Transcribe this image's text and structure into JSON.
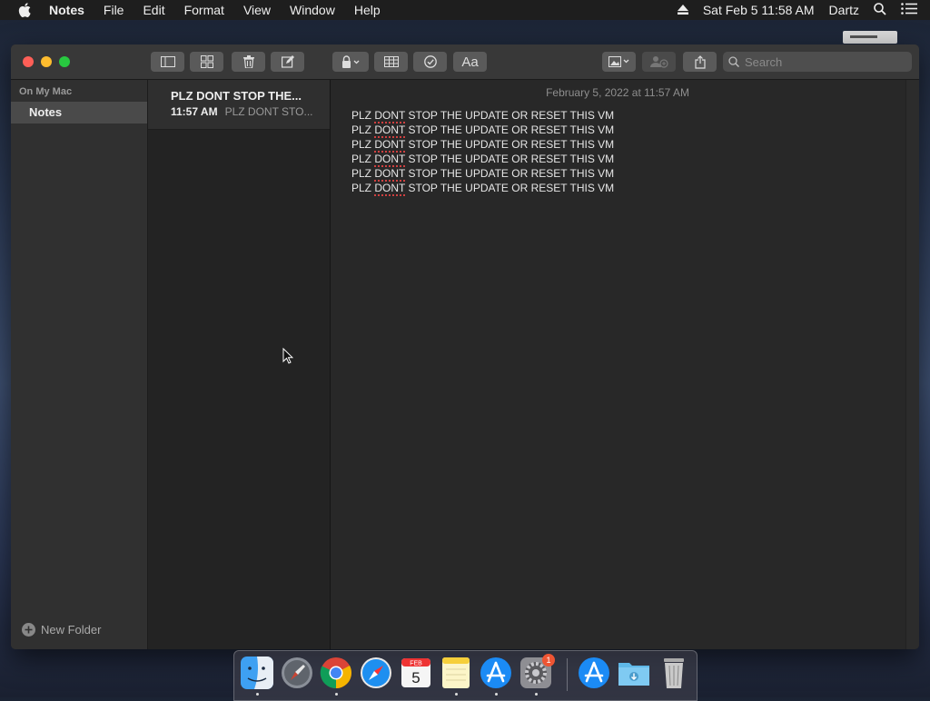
{
  "menubar": {
    "app_name": "Notes",
    "items": [
      "File",
      "Edit",
      "Format",
      "View",
      "Window",
      "Help"
    ],
    "datetime": "Sat Feb 5  11:58 AM",
    "user": "Dartz"
  },
  "toolbar": {
    "search_placeholder": "Search"
  },
  "sidebar": {
    "section_label": "On My Mac",
    "folder_label": "Notes",
    "new_folder_label": "New Folder"
  },
  "note_list": {
    "notes": [
      {
        "title": "PLZ DONT STOP THE...",
        "time": "11:57 AM",
        "preview": "PLZ DONT STO..."
      }
    ]
  },
  "editor": {
    "date": "February 5, 2022 at 11:57 AM",
    "lines": [
      {
        "before": "PLZ ",
        "misspelled": "DONT",
        "after": " STOP THE UPDATE OR RESET THIS VM"
      },
      {
        "before": "PLZ ",
        "misspelled": "DONT",
        "after": " STOP THE UPDATE OR RESET THIS VM"
      },
      {
        "before": "PLZ ",
        "misspelled": "DONT",
        "after": " STOP THE UPDATE OR RESET THIS VM"
      },
      {
        "before": "PLZ ",
        "misspelled": "DONT",
        "after": " STOP THE UPDATE OR RESET THIS VM"
      },
      {
        "before": "PLZ ",
        "misspelled": "DONT",
        "after": " STOP THE UPDATE OR RESET THIS VM"
      },
      {
        "before": "PLZ ",
        "misspelled": "DONT",
        "after": " STOP THE UPDATE OR RESET THIS VM"
      }
    ]
  },
  "dock": {
    "calendar_month": "FEB",
    "calendar_day": "5",
    "system_prefs_badge": "1"
  }
}
